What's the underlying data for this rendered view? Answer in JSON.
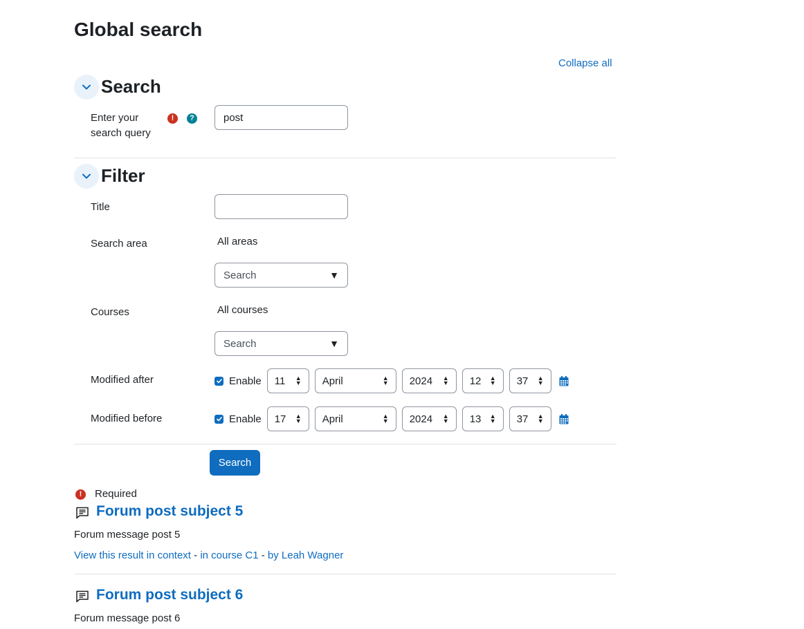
{
  "page": {
    "title": "Global search",
    "collapse_all": "Collapse all"
  },
  "search_section": {
    "title": "Search",
    "query_label": "Enter your search query",
    "query_value": "post"
  },
  "filter_section": {
    "title": "Filter",
    "title_label": "Title",
    "title_value": "",
    "search_area": {
      "label": "Search area",
      "selected": "All areas",
      "placeholder": "Search"
    },
    "courses": {
      "label": "Courses",
      "selected": "All courses",
      "placeholder": "Search"
    },
    "modified_after": {
      "label": "Modified after",
      "enable_label": "Enable",
      "enabled": true,
      "day": "11",
      "month": "April",
      "year": "2024",
      "hour": "12",
      "minute": "37"
    },
    "modified_before": {
      "label": "Modified before",
      "enable_label": "Enable",
      "enabled": true,
      "day": "17",
      "month": "April",
      "year": "2024",
      "hour": "13",
      "minute": "37"
    }
  },
  "submit_label": "Search",
  "required_note": "Required",
  "results": [
    {
      "title": "Forum post subject 5",
      "message": "Forum message post 5",
      "context_link": "View this result in context",
      "sep1": " - ",
      "course_link": "in course C1",
      "sep2": " - ",
      "author_link": "by Leah Wagner"
    },
    {
      "title": "Forum post subject 6",
      "message": "Forum message post 6"
    }
  ],
  "colors": {
    "accent": "#0f6cbf",
    "error": "#ca3120",
    "help": "#008196",
    "text": "#1d2125"
  },
  "icons": {
    "section_toggle": "chevron-down-icon",
    "required": "exclamation-circle-icon",
    "help": "question-circle-icon",
    "calendar": "calendar-icon",
    "forum": "forum-post-icon"
  }
}
